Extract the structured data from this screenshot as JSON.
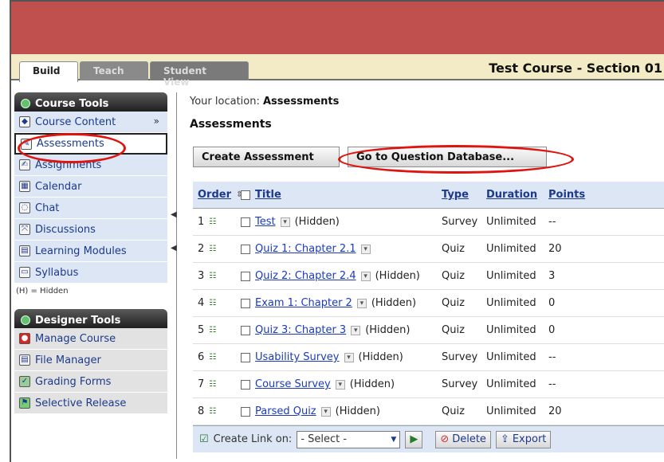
{
  "tabs": [
    "Build",
    "Teach",
    "Student View"
  ],
  "course_title": "Test Course - Section 01",
  "course_tools": {
    "heading": "Course Tools",
    "items": [
      {
        "label": "Course Content",
        "icon": "content-icon"
      },
      {
        "label": "Assessments",
        "icon": "assessment-icon"
      },
      {
        "label": "Assignments",
        "icon": "assignment-icon"
      },
      {
        "label": "Calendar",
        "icon": "calendar-icon"
      },
      {
        "label": "Chat",
        "icon": "chat-icon"
      },
      {
        "label": "Discussions",
        "icon": "discussion-icon"
      },
      {
        "label": "Learning Modules",
        "icon": "modules-icon"
      },
      {
        "label": "Syllabus",
        "icon": "syllabus-icon"
      }
    ],
    "note": "(H) = Hidden"
  },
  "designer_tools": {
    "heading": "Designer Tools",
    "items": [
      {
        "label": "Manage Course",
        "icon": "manage-icon"
      },
      {
        "label": "File Manager",
        "icon": "file-icon"
      },
      {
        "label": "Grading Forms",
        "icon": "grading-icon"
      },
      {
        "label": "Selective Release",
        "icon": "release-icon"
      }
    ]
  },
  "location": {
    "prefix": "Your location: ",
    "value": "Assessments"
  },
  "page_title": "Assessments",
  "buttons": {
    "create": "Create Assessment",
    "question_db": "Go to Question Database..."
  },
  "table": {
    "headers": {
      "order": "Order",
      "title": "Title",
      "type": "Type",
      "duration": "Duration",
      "points": "Points"
    },
    "rows": [
      {
        "order": "1",
        "title": "Test",
        "hidden": "(Hidden)",
        "type": "Survey",
        "duration": "Unlimited",
        "points": "--"
      },
      {
        "order": "2",
        "title": "Quiz 1: Chapter 2.1",
        "hidden": "",
        "type": "Quiz",
        "duration": "Unlimited",
        "points": "20"
      },
      {
        "order": "3",
        "title": "Quiz 2: Chapter 2.4",
        "hidden": "(Hidden)",
        "type": "Quiz",
        "duration": "Unlimited",
        "points": "3"
      },
      {
        "order": "4",
        "title": "Exam 1: Chapter 2",
        "hidden": "(Hidden)",
        "type": "Quiz",
        "duration": "Unlimited",
        "points": "0"
      },
      {
        "order": "5",
        "title": "Quiz 3: Chapter 3",
        "hidden": "(Hidden)",
        "type": "Quiz",
        "duration": "Unlimited",
        "points": "0"
      },
      {
        "order": "6",
        "title": "Usability Survey",
        "hidden": "(Hidden)",
        "type": "Survey",
        "duration": "Unlimited",
        "points": "--"
      },
      {
        "order": "7",
        "title": "Course Survey",
        "hidden": "(Hidden)",
        "type": "Survey",
        "duration": "Unlimited",
        "points": "--"
      },
      {
        "order": "8",
        "title": "Parsed Quiz",
        "hidden": "(Hidden)",
        "type": "Quiz",
        "duration": "Unlimited",
        "points": "20"
      }
    ]
  },
  "footer": {
    "create_link": "Create Link on:",
    "select": "- Select -",
    "delete": "Delete",
    "export": "Export"
  },
  "colors": {
    "banner": "#c0504d",
    "highlight_oval": "#e0140f",
    "nav_bg": "#dce6f5"
  }
}
